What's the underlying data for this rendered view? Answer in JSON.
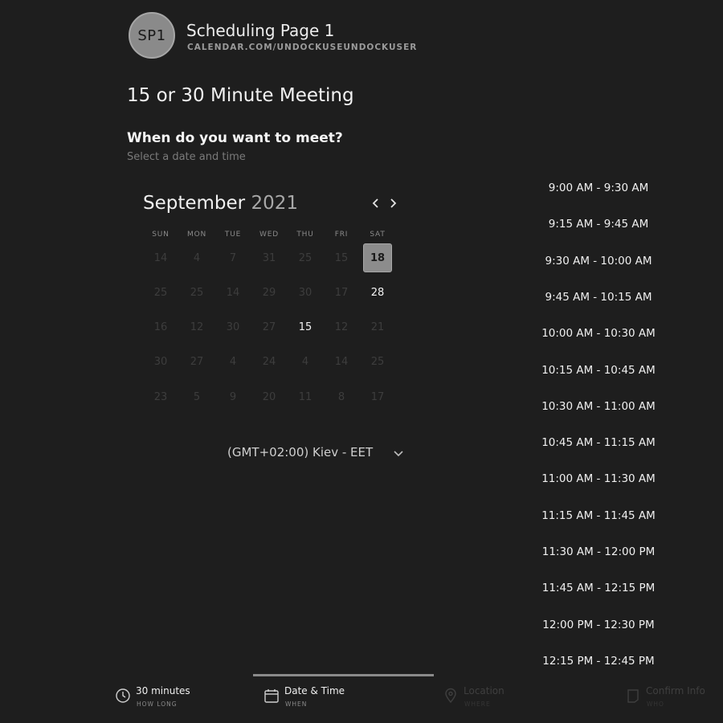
{
  "header": {
    "avatar_initials": "SP1",
    "page_name": "Scheduling Page 1",
    "page_url": "CALENDAR.COM/UNDOCKUSEUNDOCKUSER"
  },
  "meeting": {
    "title": "15 or 30 Minute Meeting",
    "question": "When do you want to meet?",
    "subtitle": "Select a date and time"
  },
  "calendar": {
    "month": "September",
    "year": "2021",
    "prev_icon": "chevron-left-icon",
    "next_icon": "chevron-right-icon",
    "weekdays": [
      "SUN",
      "MON",
      "TUE",
      "WED",
      "THU",
      "FRI",
      "SAT"
    ],
    "weeks": [
      [
        {
          "label": "14",
          "state": "disabled"
        },
        {
          "label": "4",
          "state": "disabled"
        },
        {
          "label": "7",
          "state": "disabled"
        },
        {
          "label": "31",
          "state": "disabled"
        },
        {
          "label": "25",
          "state": "disabled"
        },
        {
          "label": "15",
          "state": "disabled"
        },
        {
          "label": "18",
          "state": "selected"
        }
      ],
      [
        {
          "label": "25",
          "state": "disabled"
        },
        {
          "label": "25",
          "state": "disabled"
        },
        {
          "label": "14",
          "state": "disabled"
        },
        {
          "label": "29",
          "state": "disabled"
        },
        {
          "label": "30",
          "state": "disabled"
        },
        {
          "label": "17",
          "state": "disabled"
        },
        {
          "label": "28",
          "state": "available"
        }
      ],
      [
        {
          "label": "16",
          "state": "disabled"
        },
        {
          "label": "12",
          "state": "disabled"
        },
        {
          "label": "30",
          "state": "disabled"
        },
        {
          "label": "27",
          "state": "disabled"
        },
        {
          "label": "15",
          "state": "available"
        },
        {
          "label": "12",
          "state": "disabled"
        },
        {
          "label": "21",
          "state": "disabled"
        }
      ],
      [
        {
          "label": "30",
          "state": "disabled"
        },
        {
          "label": "27",
          "state": "disabled"
        },
        {
          "label": "4",
          "state": "disabled"
        },
        {
          "label": "24",
          "state": "disabled"
        },
        {
          "label": "4",
          "state": "disabled"
        },
        {
          "label": "14",
          "state": "disabled"
        },
        {
          "label": "25",
          "state": "disabled"
        }
      ],
      [
        {
          "label": "23",
          "state": "disabled"
        },
        {
          "label": "5",
          "state": "disabled"
        },
        {
          "label": "9",
          "state": "disabled"
        },
        {
          "label": "20",
          "state": "disabled"
        },
        {
          "label": "11",
          "state": "disabled"
        },
        {
          "label": "8",
          "state": "disabled"
        },
        {
          "label": "17",
          "state": "disabled"
        }
      ]
    ]
  },
  "timezone": {
    "label": "(GMT+02:00) Kiev - EET",
    "icon": "chevron-down-icon"
  },
  "time_slots": [
    "9:00 AM - 9:30 AM",
    "9:15 AM - 9:45 AM",
    "9:30 AM - 10:00 AM",
    "9:45 AM - 10:15 AM",
    "10:00 AM - 10:30 AM",
    "10:15 AM - 10:45 AM",
    "10:30 AM - 11:00 AM",
    "10:45 AM - 11:15 AM",
    "11:00 AM - 11:30 AM",
    "11:15 AM - 11:45 AM",
    "11:30 AM - 12:00 PM",
    "11:45 AM - 12:15 PM",
    "12:00 PM - 12:30 PM",
    "12:15 PM - 12:45 PM"
  ],
  "steps": [
    {
      "label": "30 minutes",
      "sub": "HOW LONG",
      "icon": "clock-icon",
      "state": "active"
    },
    {
      "label": "Date & Time",
      "sub": "WHEN",
      "icon": "calendar-icon",
      "state": "active"
    },
    {
      "label": "Location",
      "sub": "WHERE",
      "icon": "map-pin-icon",
      "state": "inactive"
    },
    {
      "label": "Confirm Info",
      "sub": "WHO",
      "icon": "user-card-icon",
      "state": "inactive"
    }
  ],
  "colors": {
    "background": "#1e1e1e",
    "selected_day": "#8c8c8c",
    "disabled_text": "#3d3d3d",
    "active_text": "#f0f0f0"
  }
}
